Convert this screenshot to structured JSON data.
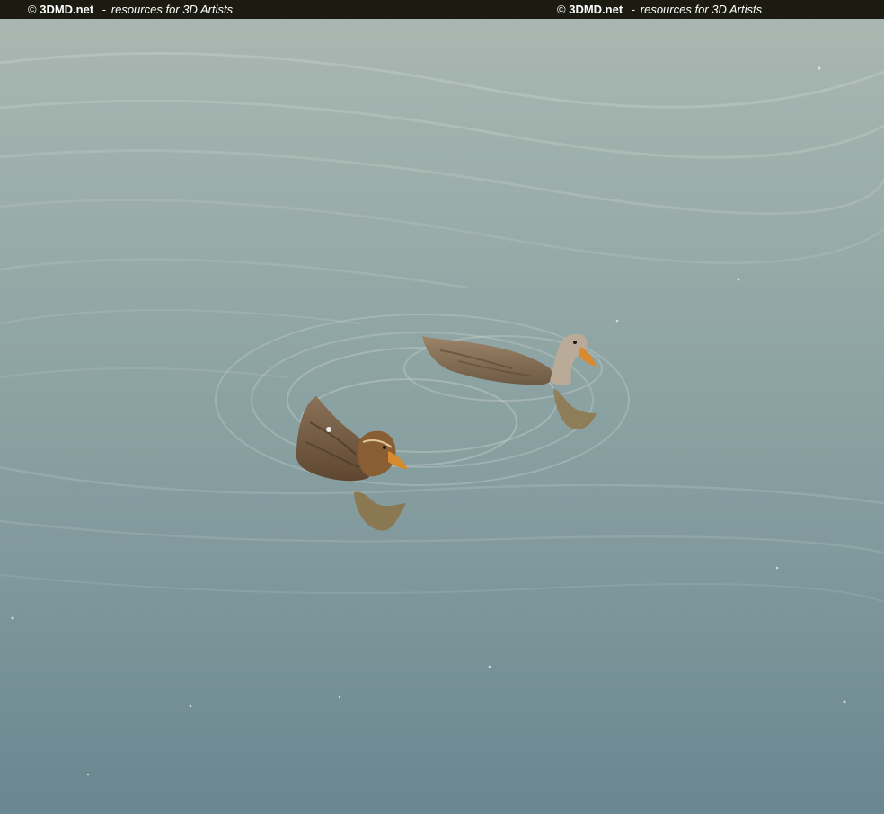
{
  "watermark": {
    "copyright_symbol": "©",
    "brand": "3DMD.net",
    "separator": "-",
    "tagline": "resources for 3D Artists"
  },
  "scene": {
    "colors": {
      "bar": "#1b1b12",
      "water_light": "#a7b6b0",
      "water_dark": "#66818a",
      "duck_brown": "#7a5a3a",
      "bill_orange": "#d4822a"
    }
  }
}
